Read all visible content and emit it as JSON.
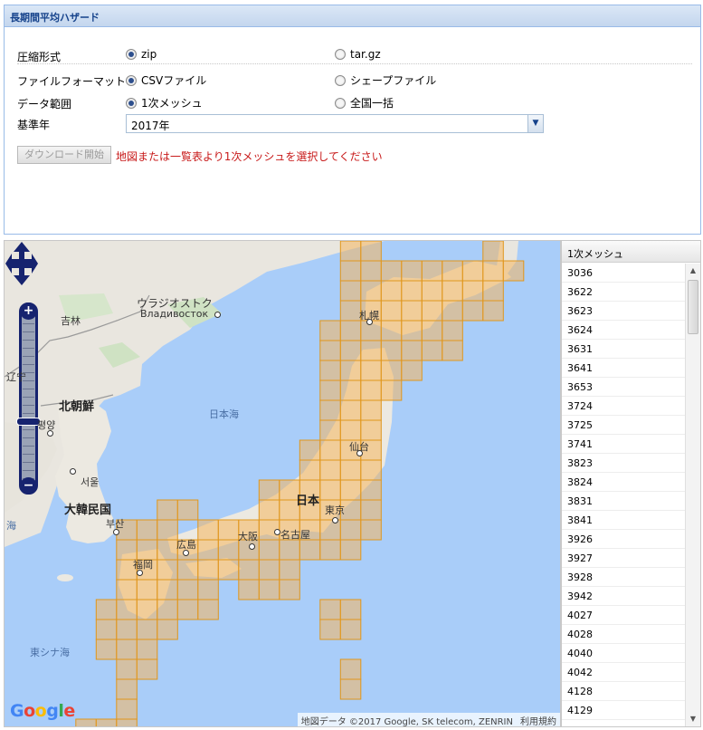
{
  "panel": {
    "title": "長期間平均ハザード"
  },
  "form": {
    "compression": {
      "label": "圧縮形式",
      "options": [
        "zip",
        "tar.gz"
      ],
      "selected": "zip"
    },
    "file_format": {
      "label": "ファイルフォーマット",
      "options": [
        "CSVファイル",
        "シェープファイル"
      ],
      "selected": "CSVファイル"
    },
    "data_range": {
      "label": "データ範囲",
      "options": [
        "1次メッシュ",
        "全国一括"
      ],
      "selected": "1次メッシュ"
    },
    "base_year": {
      "label": "基準年",
      "value": "2017年"
    },
    "download_button": "ダウンロード開始",
    "message": "地図または一覧表より1次メッシュを選択してください"
  },
  "map": {
    "labels": {
      "vladivostok_jp": "ウラジオストク",
      "vladivostok_ru": "Владивосток",
      "jilin": "吉林",
      "liaoning": "辽宁",
      "north_korea": "北朝鮮",
      "pyongyang": "평양",
      "seoul": "서울",
      "south_korea": "大韓民国",
      "busan": "부산",
      "sea_of_japan": "日本海",
      "east_china_sea": "東シナ海",
      "yellow_sea": "海",
      "japan": "日本",
      "sapporo": "札幌",
      "sendai": "仙台",
      "tokyo": "東京",
      "nagoya": "名古屋",
      "osaka": "大阪",
      "hiroshima": "広島",
      "fukuoka": "福岡"
    },
    "attribution": "地図データ ©2017 Google, SK telecom, ZENRIN",
    "terms": "利用規約",
    "logo": "Google",
    "mesh_fill": "#f5b75e",
    "mesh_stroke": "#e0961c"
  },
  "mesh_list": {
    "header": "1次メッシュ",
    "items": [
      "3036",
      "3622",
      "3623",
      "3624",
      "3631",
      "3641",
      "3653",
      "3724",
      "3725",
      "3741",
      "3823",
      "3824",
      "3831",
      "3841",
      "3926",
      "3927",
      "3928",
      "3942",
      "4027",
      "4028",
      "4040",
      "4042",
      "4128",
      "4129"
    ]
  }
}
